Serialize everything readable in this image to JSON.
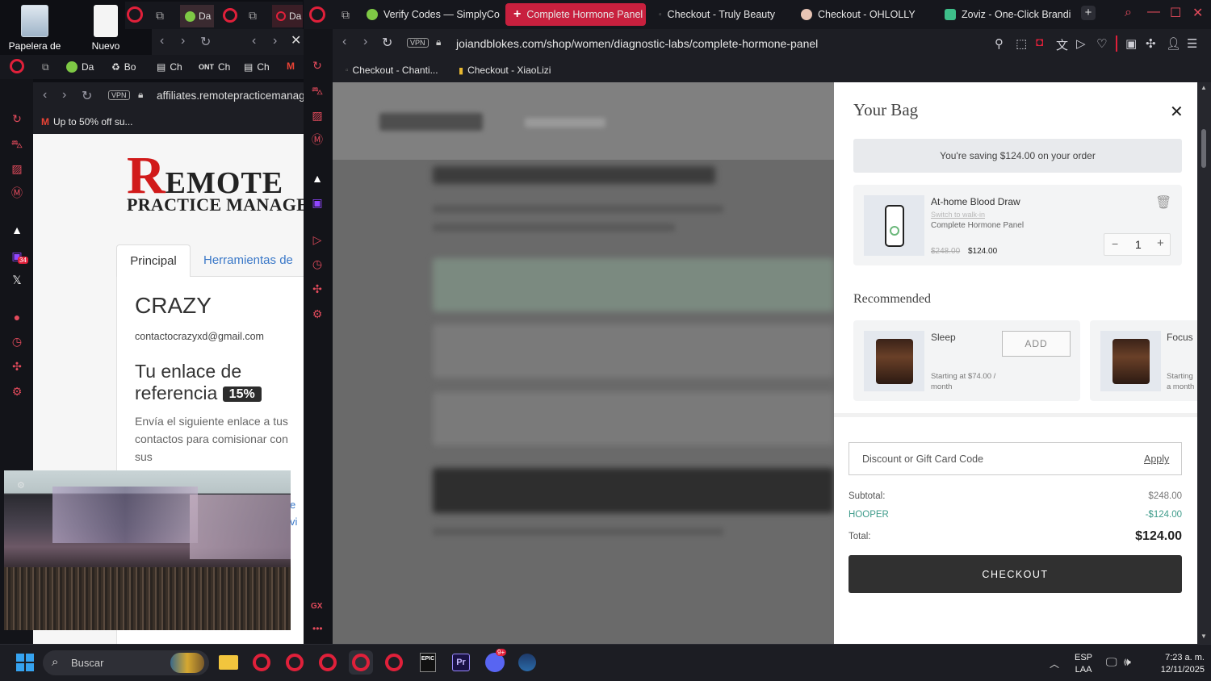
{
  "desktop": {
    "icons": [
      {
        "label": "Papelera de",
        "icon": "recycle-bin-icon"
      },
      {
        "label": "Nuevo",
        "icon": "document-icon"
      }
    ]
  },
  "left_window": {
    "mini_tabs": [
      "Da",
      "Da"
    ],
    "bookmarks": [
      "Da",
      "Bo",
      "Ch",
      "Ch",
      "Ch"
    ],
    "url": "affiliates.remotepracticemanag",
    "gmail_bookmark": "Up to 50% off su...",
    "logo": {
      "big_letter": "R",
      "line1": "EMOTE",
      "line2": "PRACTICE MANAGERS"
    },
    "tabs": [
      "Principal",
      "Herramientas de"
    ],
    "user_name": "CRAZY",
    "email": "contactocrazyxd@gmail.com",
    "referral_title": "Tu enlace de referencia",
    "referral_badge": "15%",
    "referral_desc": "Envía el siguiente enlace a tus contactos para comisionar con sus",
    "cut_text": [
      "e",
      "vi"
    ]
  },
  "browser": {
    "tabs": [
      {
        "label": "Verify Codes — SimplyCo",
        "active": false
      },
      {
        "label": "Complete Hormone Panel",
        "active": true
      },
      {
        "label": "Checkout - Truly Beauty",
        "active": false
      },
      {
        "label": "Checkout - OHLOLLY",
        "active": false
      },
      {
        "label": "Zoviz - One-Click Brandi",
        "active": false
      }
    ],
    "url": "joiandblokes.com/shop/women/diagnostic-labs/complete-hormone-panel",
    "vpn": "VPN",
    "bookmarks": [
      "Checkout - Chanti...",
      "Checkout - XiaoLizi"
    ],
    "gx_label": "GX"
  },
  "bag": {
    "title": "Your Bag",
    "saving_banner": "You're saving $124.00 on your order",
    "item": {
      "name": "At-home Blood Draw",
      "switch_link": "Switch to walk-in",
      "subtitle": "Complete Hormone Panel",
      "old_price": "$248.00",
      "price": "$124.00",
      "quantity": "1"
    },
    "recommended_title": "Recommended",
    "recommended": [
      {
        "name": "Sleep",
        "price": "Starting at $74.00 / month",
        "add_label": "ADD"
      },
      {
        "name": "Focus",
        "price": "Starting a month"
      }
    ],
    "discount_placeholder": "Discount or Gift Card Code",
    "apply_label": "Apply",
    "subtotal_label": "Subtotal:",
    "subtotal_value": "$248.00",
    "discount_code": "HOOPER",
    "discount_value": "-$124.00",
    "total_label": "Total:",
    "total_value": "$124.00",
    "checkout_label": "CHECKOUT"
  },
  "taskbar": {
    "search_placeholder": "Buscar",
    "lang_line1": "ESP",
    "lang_line2": "LAA",
    "time": "7:23 a. m.",
    "date": "12/11/2025",
    "discord_badge": "9+",
    "sidebar_badge": "34"
  }
}
